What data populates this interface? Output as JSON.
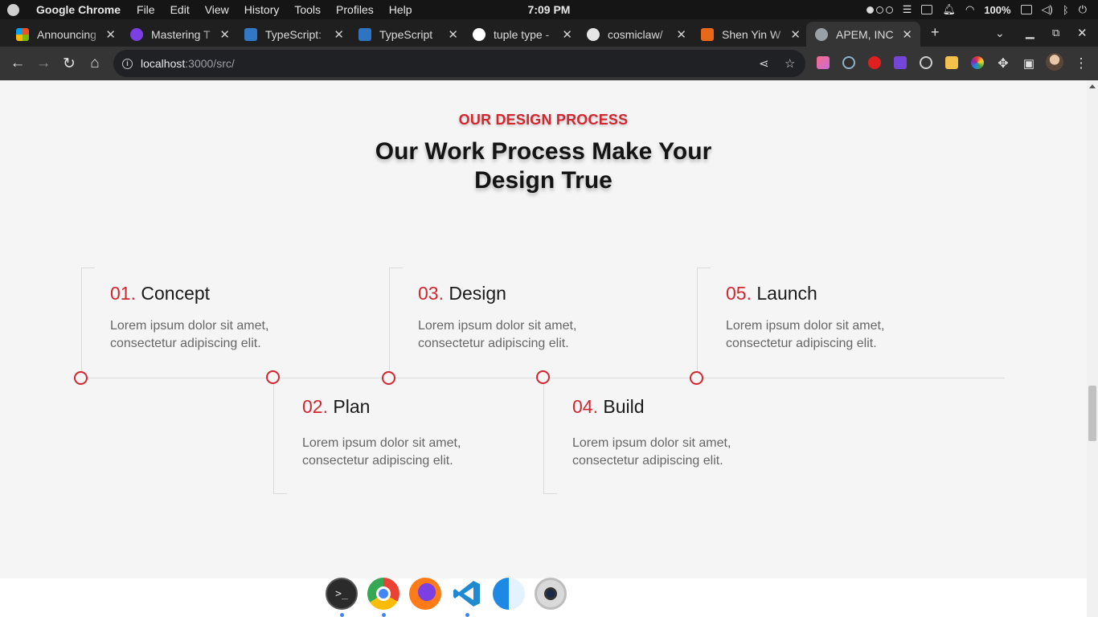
{
  "os_bar": {
    "app_name": "Google Chrome",
    "menu": [
      "File",
      "Edit",
      "View",
      "History",
      "Tools",
      "Profiles",
      "Help"
    ],
    "clock": "7:09 PM",
    "battery": "100%"
  },
  "tabs": [
    {
      "label": "Announcing",
      "favicon": "microsoft-icon",
      "color": "#f25022"
    },
    {
      "label": "Mastering T",
      "favicon": "course-icon",
      "color": "#7b3fe4"
    },
    {
      "label": "TypeScript:",
      "favicon": "typescript-icon",
      "color": "#3178c6"
    },
    {
      "label": "TypeScript",
      "favicon": "typescript-tutorial-icon",
      "color": "#2f74c0"
    },
    {
      "label": "tuple type -",
      "favicon": "google-icon",
      "color": "#ffffff"
    },
    {
      "label": "cosmiclaw/",
      "favicon": "github-icon",
      "color": "#e6e6e6"
    },
    {
      "label": "Shen Yin W",
      "favicon": "bookmark-icon",
      "color": "#e8681a"
    },
    {
      "label": "APEM, INC",
      "favicon": "globe-icon",
      "color": "#9aa0a6"
    }
  ],
  "url": {
    "host": "localhost",
    "path": ":3000/src/"
  },
  "page": {
    "eyebrow": "OUR DESIGN PROCESS",
    "heading": "Our Work Process Make Your Design True",
    "steps": [
      {
        "num": "01.",
        "title": "Concept",
        "desc": "Lorem ipsum dolor sit amet, consectetur adipiscing elit."
      },
      {
        "num": "02.",
        "title": "Plan",
        "desc": "Lorem ipsum dolor sit amet, consectetur adipiscing elit."
      },
      {
        "num": "03.",
        "title": "Design",
        "desc": "Lorem ipsum dolor sit amet, consectetur adipiscing elit."
      },
      {
        "num": "04.",
        "title": "Build",
        "desc": "Lorem ipsum dolor sit amet, consectetur adipiscing elit."
      },
      {
        "num": "05.",
        "title": "Launch",
        "desc": "Lorem ipsum dolor sit amet, consectetur adipiscing elit."
      }
    ]
  },
  "colors": {
    "accent": "#d3262f"
  },
  "dock": [
    "terminal-icon",
    "chrome-icon",
    "firefox-icon",
    "vscode-icon",
    "finder-icon",
    "camera-icon"
  ]
}
